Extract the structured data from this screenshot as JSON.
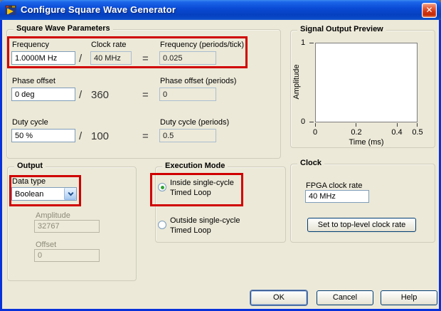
{
  "window": {
    "title": "Configure Square Wave Generator",
    "close_glyph": "✕"
  },
  "colors": {
    "dialog_bg": "#ECE9D8",
    "titlebar_blue": "#0A4AD4",
    "frame_blue": "#0831D9",
    "highlight_red": "#D00000",
    "input_border": "#7F9DB9"
  },
  "square_wave_parameters": {
    "title": "Square Wave Parameters",
    "rows": {
      "0": {
        "label": "Frequency",
        "value": "1.0000M Hz",
        "operator": "/",
        "divisor_label": "Clock rate",
        "divisor_value": "40 MHz",
        "equals": "=",
        "result_label": "Frequency (periods/tick)",
        "result_value": "0.025"
      },
      "1": {
        "label": "Phase offset",
        "value": "0 deg",
        "operator": "/",
        "divisor": "360",
        "equals": "=",
        "result_label": "Phase offset (periods)",
        "result_value": "0"
      },
      "2": {
        "label": "Duty cycle",
        "value": "50 %",
        "operator": "/",
        "divisor": "100",
        "equals": "=",
        "result_label": "Duty cycle (periods)",
        "result_value": "0.5"
      }
    }
  },
  "signal_output_preview": {
    "title": "Signal Output Preview",
    "ylabel": "Amplitude",
    "xlabel": "Time (ms)",
    "y_ticks": {
      "top": "1",
      "bottom": "0"
    },
    "x_ticks": {
      "0": "0",
      "1": "0.2",
      "2": "0.4",
      "3": "0.5"
    }
  },
  "chart_data": {
    "type": "line",
    "title": "Signal Output Preview",
    "xlabel": "Time (ms)",
    "ylabel": "Amplitude",
    "xlim": [
      0,
      0.5
    ],
    "ylim": [
      0,
      1
    ],
    "x_ticks": [
      0,
      0.2,
      0.4,
      0.5
    ],
    "y_ticks": [
      0,
      1
    ],
    "series": []
  },
  "output": {
    "title": "Output",
    "data_type_label": "Data type",
    "data_type_value": "Boolean",
    "amplitude_label": "Amplitude",
    "amplitude_value": "32767",
    "offset_label": "Offset",
    "offset_value": "0"
  },
  "execution_mode": {
    "title": "Execution Mode",
    "options": {
      "0": {
        "line1": "Inside single-cycle",
        "line2": "Timed Loop",
        "selected": true
      },
      "1": {
        "line1": "Outside single-cycle",
        "line2": "Timed Loop",
        "selected": false
      }
    }
  },
  "clock": {
    "title": "Clock",
    "fpga_label": "FPGA clock rate",
    "fpga_value": "40 MHz",
    "set_button_label": "Set to top-level clock rate"
  },
  "footer": {
    "ok": "OK",
    "cancel": "Cancel",
    "help": "Help"
  }
}
